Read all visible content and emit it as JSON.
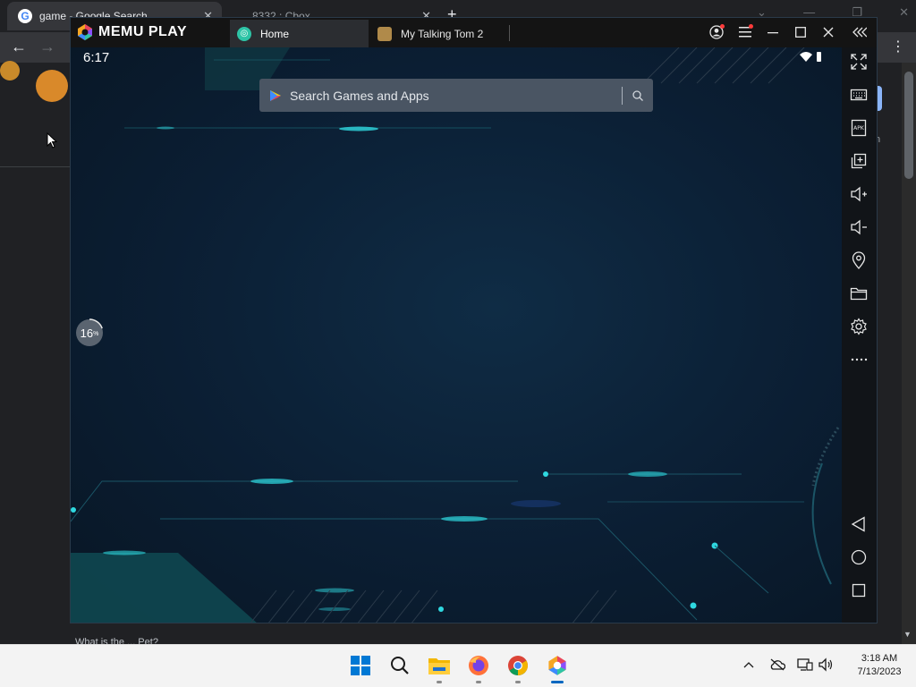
{
  "chrome": {
    "tabs": [
      {
        "title": "game - Google Search",
        "favicon": "google-icon"
      },
      {
        "title": "8332 : Cbox"
      }
    ],
    "new_tab": "+",
    "page_snippet": "What is the ... Pet?",
    "side_text": "n"
  },
  "memu": {
    "brand": "MEMU PLAY",
    "tabs": [
      {
        "label": "Home",
        "icon": "home-app-icon"
      },
      {
        "label": "My Talking Tom 2",
        "icon": "talking-tom-icon"
      }
    ],
    "titlebar_icons": [
      "account-icon",
      "menu-icon",
      "minimize-icon",
      "maximize-icon",
      "close-icon",
      "collapse-icon"
    ],
    "android": {
      "time": "6:17",
      "search_placeholder": "Search Games and Apps",
      "progress_value": "16",
      "progress_unit": "%"
    },
    "sidebar": [
      "fullscreen-icon",
      "keyboard-icon",
      "apk-icon",
      "multi-instance-icon",
      "volume-up-icon",
      "volume-down-icon",
      "location-icon",
      "folder-icon",
      "settings-icon",
      "more-icon",
      "back-icon",
      "home-icon",
      "recents-icon"
    ],
    "colors": {
      "accent": "#2ec4a6",
      "background": "#0b1e33",
      "glow": "#1fd1c8"
    }
  },
  "taskbar": {
    "apps": [
      "windows-start-icon",
      "search-icon",
      "file-explorer-icon",
      "firefox-icon",
      "chrome-icon",
      "memu-icon"
    ],
    "time": "3:18 AM",
    "date": "7/13/2023"
  }
}
